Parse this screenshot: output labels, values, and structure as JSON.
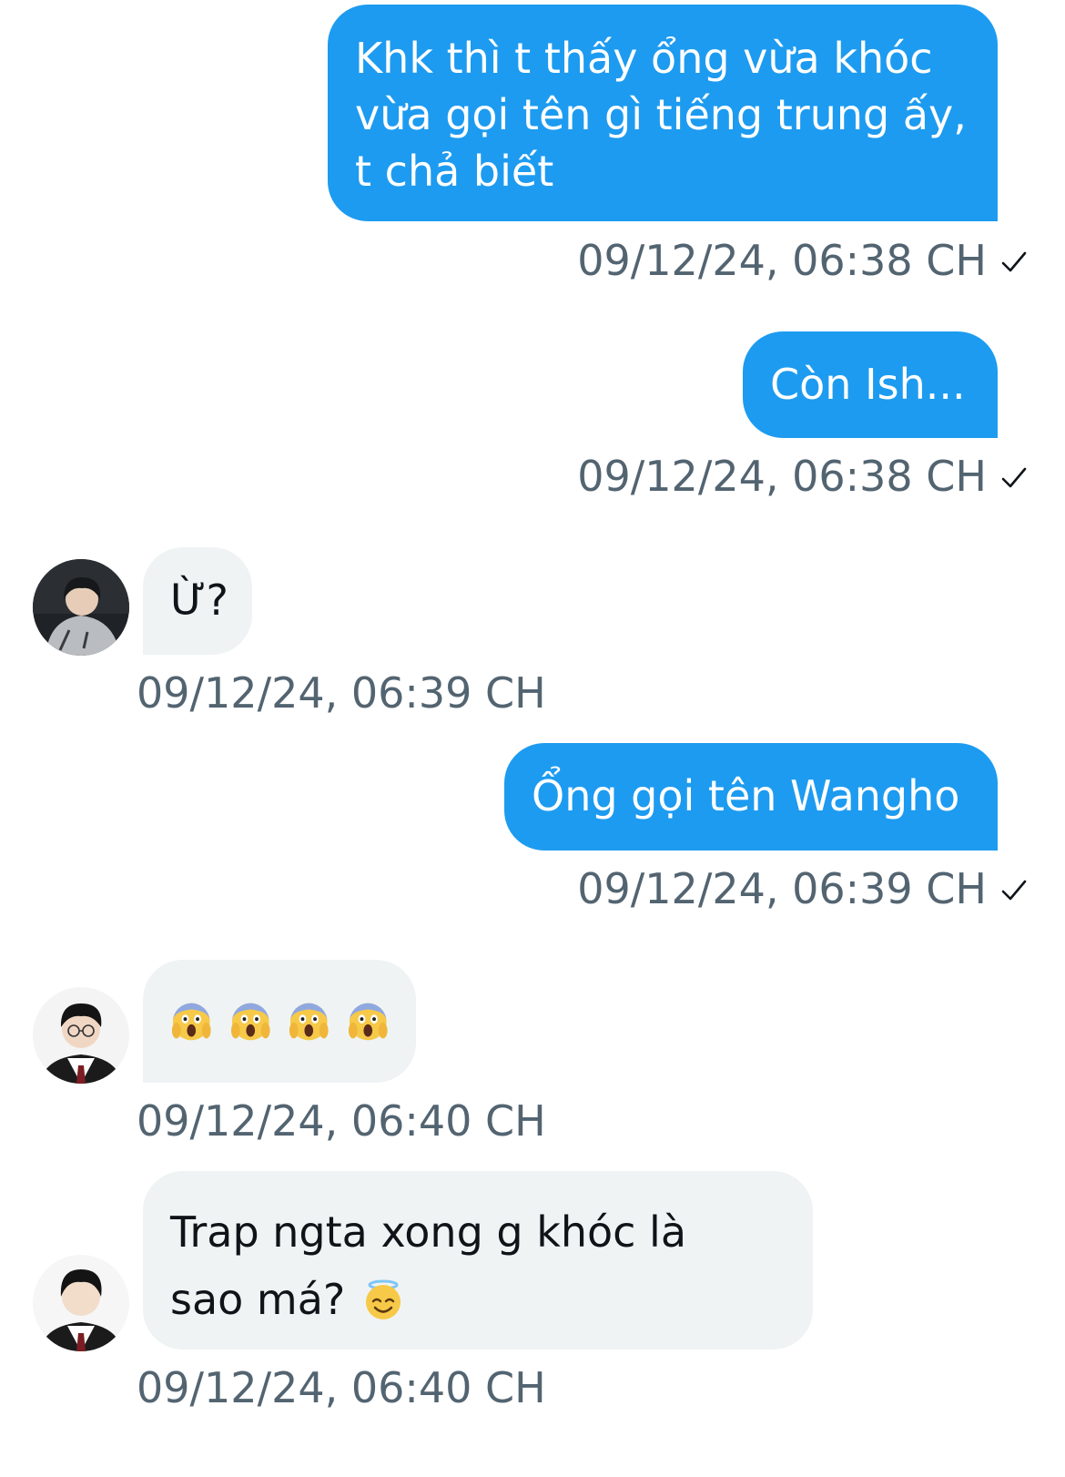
{
  "messages": [
    {
      "direction": "outgoing",
      "lines": [
        "Khk thì t thấy ổng vừa khóc",
        "vừa gọi tên gì tiếng trung ấy,",
        "t chả biết"
      ],
      "timestamp": "09/12/24, 06:38 CH",
      "status_icon": "check-icon"
    },
    {
      "direction": "outgoing",
      "text": "Còn Ish...",
      "timestamp": "09/12/24, 06:38 CH",
      "status_icon": "check-icon"
    },
    {
      "direction": "incoming",
      "text": "Ừ?",
      "timestamp": "09/12/24, 06:39 CH",
      "avatar": "avatar-hoodie"
    },
    {
      "direction": "outgoing",
      "text": "Ổng gọi tên Wangho",
      "timestamp": "09/12/24, 06:39 CH",
      "status_icon": "check-icon"
    },
    {
      "direction": "incoming",
      "emojis": [
        "face-screaming-in-fear-icon",
        "face-screaming-in-fear-icon",
        "face-screaming-in-fear-icon",
        "face-screaming-in-fear-icon"
      ],
      "timestamp": "09/12/24, 06:40 CH",
      "avatar": "avatar-glasses"
    },
    {
      "direction": "incoming",
      "lines": [
        "Trap ngta xong g khóc là",
        "sao má?"
      ],
      "trailing_emoji": "smiling-face-with-halo-icon",
      "timestamp": "09/12/24, 06:40 CH",
      "avatar": "avatar-uniform"
    }
  ],
  "colors": {
    "outgoing_bubble": "#1d9bf0",
    "incoming_bubble": "#eff3f4",
    "timestamp_text": "#536471",
    "body_text": "#0f1419"
  }
}
